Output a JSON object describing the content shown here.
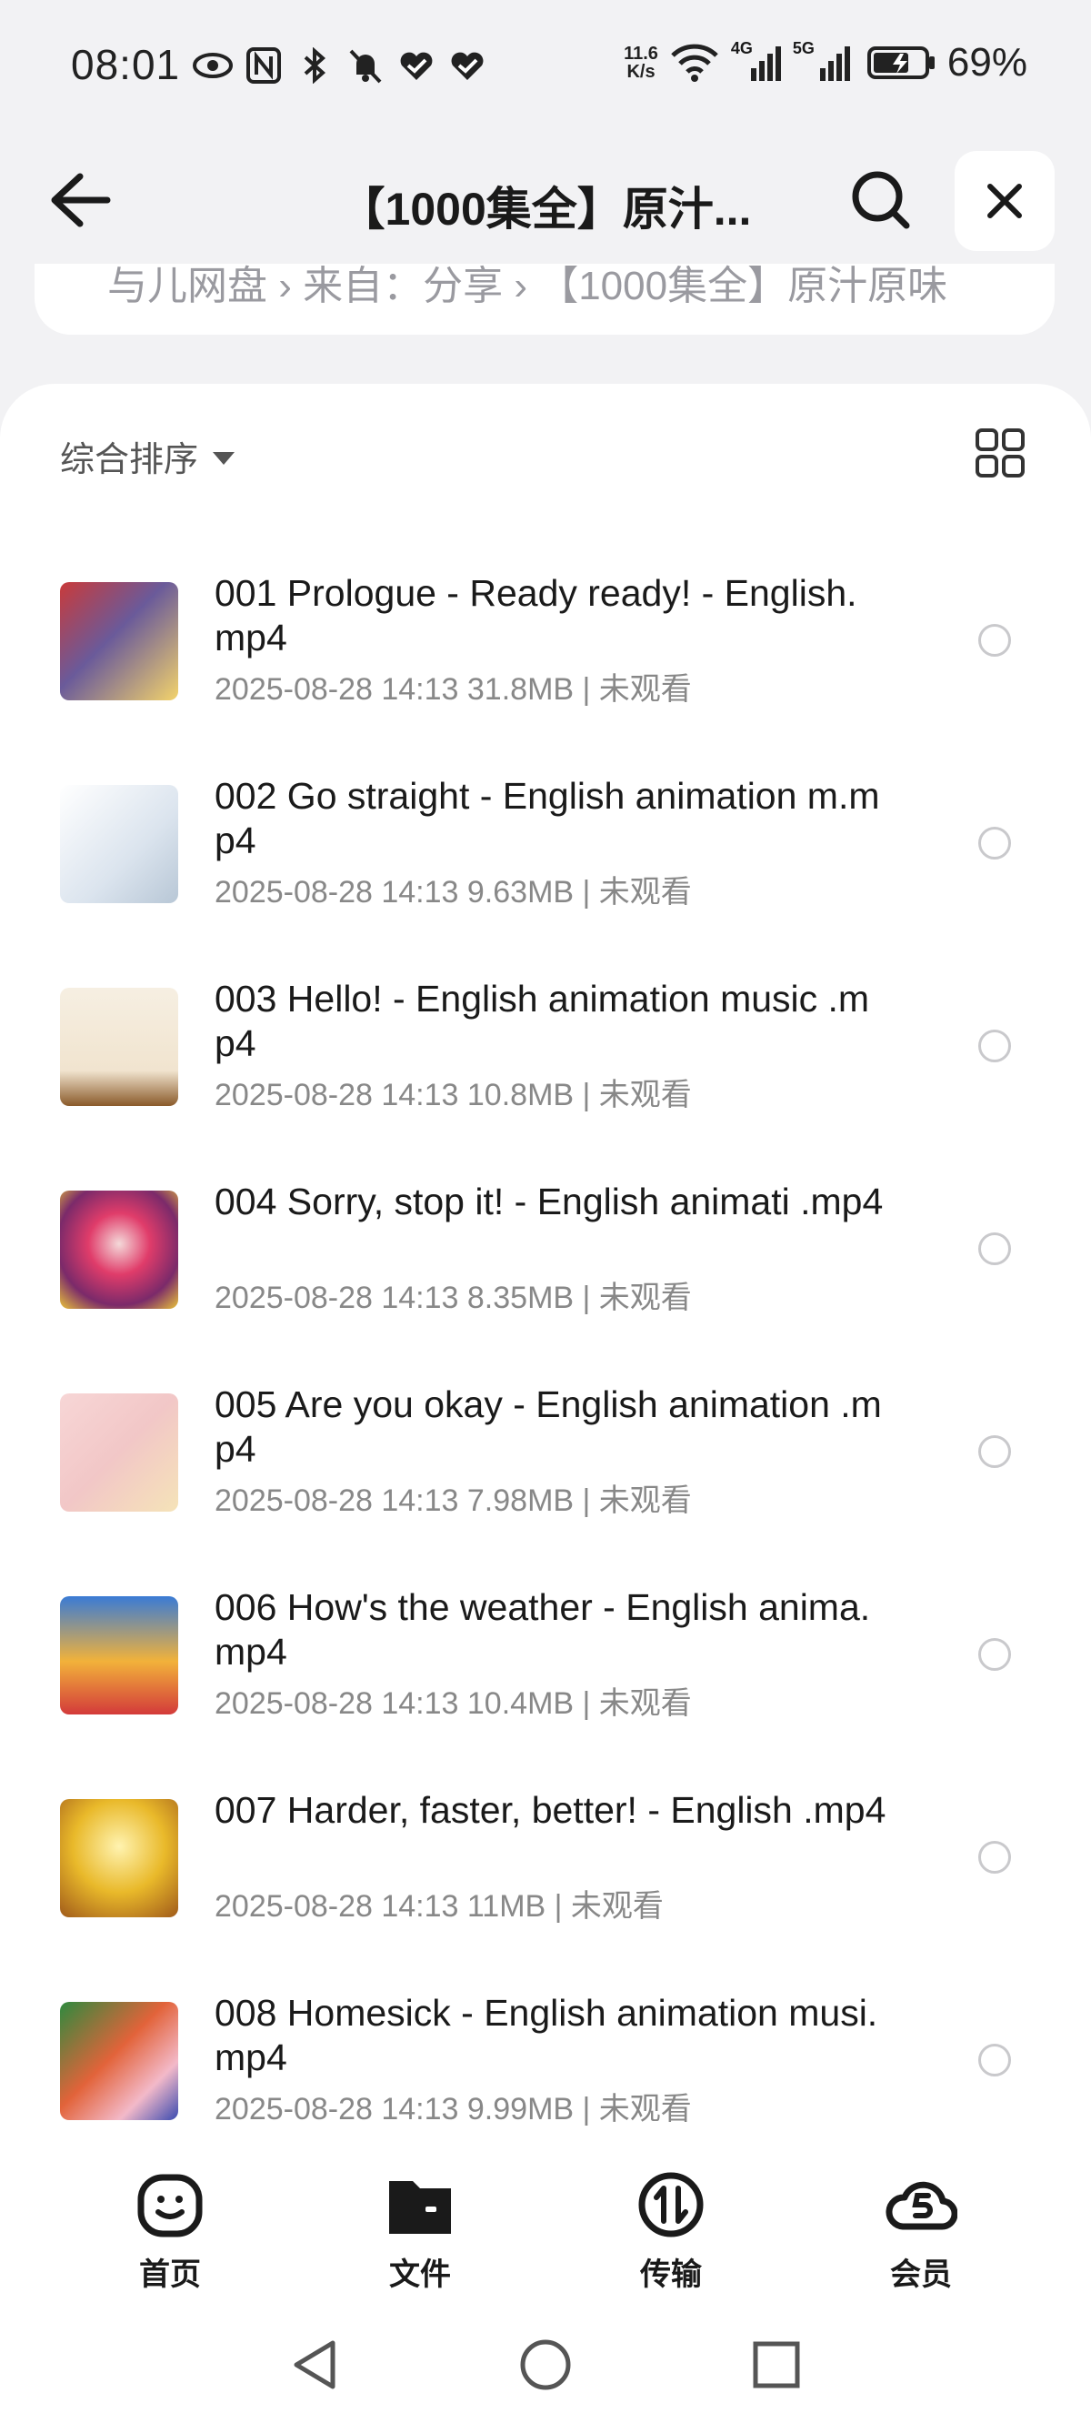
{
  "status_bar": {
    "time": "08:01",
    "net_speed_value": "11.6",
    "net_speed_unit": "K/s",
    "net_4g": "4G",
    "net_5g": "5G",
    "battery_percent": "69%",
    "icons": [
      "eye-icon",
      "nfc-icon",
      "bluetooth-icon",
      "mute-icon",
      "heart-check-icon",
      "heart-check-icon",
      "wifi-icon",
      "signal-icon",
      "signal-icon",
      "battery-icon"
    ]
  },
  "header": {
    "title": "【1000集全】原汁...",
    "icons": [
      "back-arrow-icon",
      "search-icon",
      "close-icon"
    ]
  },
  "breadcrumb": {
    "text": "与儿网盘 › 来自：分享 › 【1000集全】原汁原味"
  },
  "sort": {
    "label": "综合排序"
  },
  "files": [
    {
      "name": "001 Prologue - Ready ready! - English.mp4",
      "meta": "2025-08-28 14:13  31.8MB | 未观看",
      "thumb_color": "#6a5a9a"
    },
    {
      "name": "002 Go straight - English animation m.mp4",
      "meta": "2025-08-28 14:13  9.63MB | 未观看",
      "thumb_color": "#e8eef4"
    },
    {
      "name": "003 Hello! - English animation music .mp4",
      "meta": "2025-08-28 14:13  10.8MB | 未观看",
      "thumb_color": "#f1e4cf"
    },
    {
      "name": "004 Sorry, stop it! - English animati .mp4",
      "meta": "2025-08-28 14:13  8.35MB | 未观看",
      "thumb_color": "#7b2a6a"
    },
    {
      "name": "005 Are you okay - English animation .mp4",
      "meta": "2025-08-28 14:13  7.98MB | 未观看",
      "thumb_color": "#f2c7c7"
    },
    {
      "name": "006 How's the weather - English anima.mp4",
      "meta": "2025-08-28 14:13  10.4MB | 未观看",
      "thumb_color": "#3a7bd5"
    },
    {
      "name": "007 Harder, faster, better! - English .mp4",
      "meta": "2025-08-28 14:13  11MB | 未观看",
      "thumb_color": "#e9b92a"
    },
    {
      "name": "008 Homesick - English animation musi.mp4",
      "meta": "2025-08-28 14:13  9.99MB | 未观看",
      "thumb_color": "#2e8a3e"
    }
  ],
  "bottom_nav": [
    {
      "label": "首页",
      "icon": "smiley-home-icon"
    },
    {
      "label": "文件",
      "icon": "folder-icon"
    },
    {
      "label": "传输",
      "icon": "transfer-icon"
    },
    {
      "label": "会员",
      "icon": "vip-cloud-icon"
    }
  ],
  "system_nav": [
    "back-triangle-icon",
    "home-circle-icon",
    "recents-square-icon"
  ]
}
